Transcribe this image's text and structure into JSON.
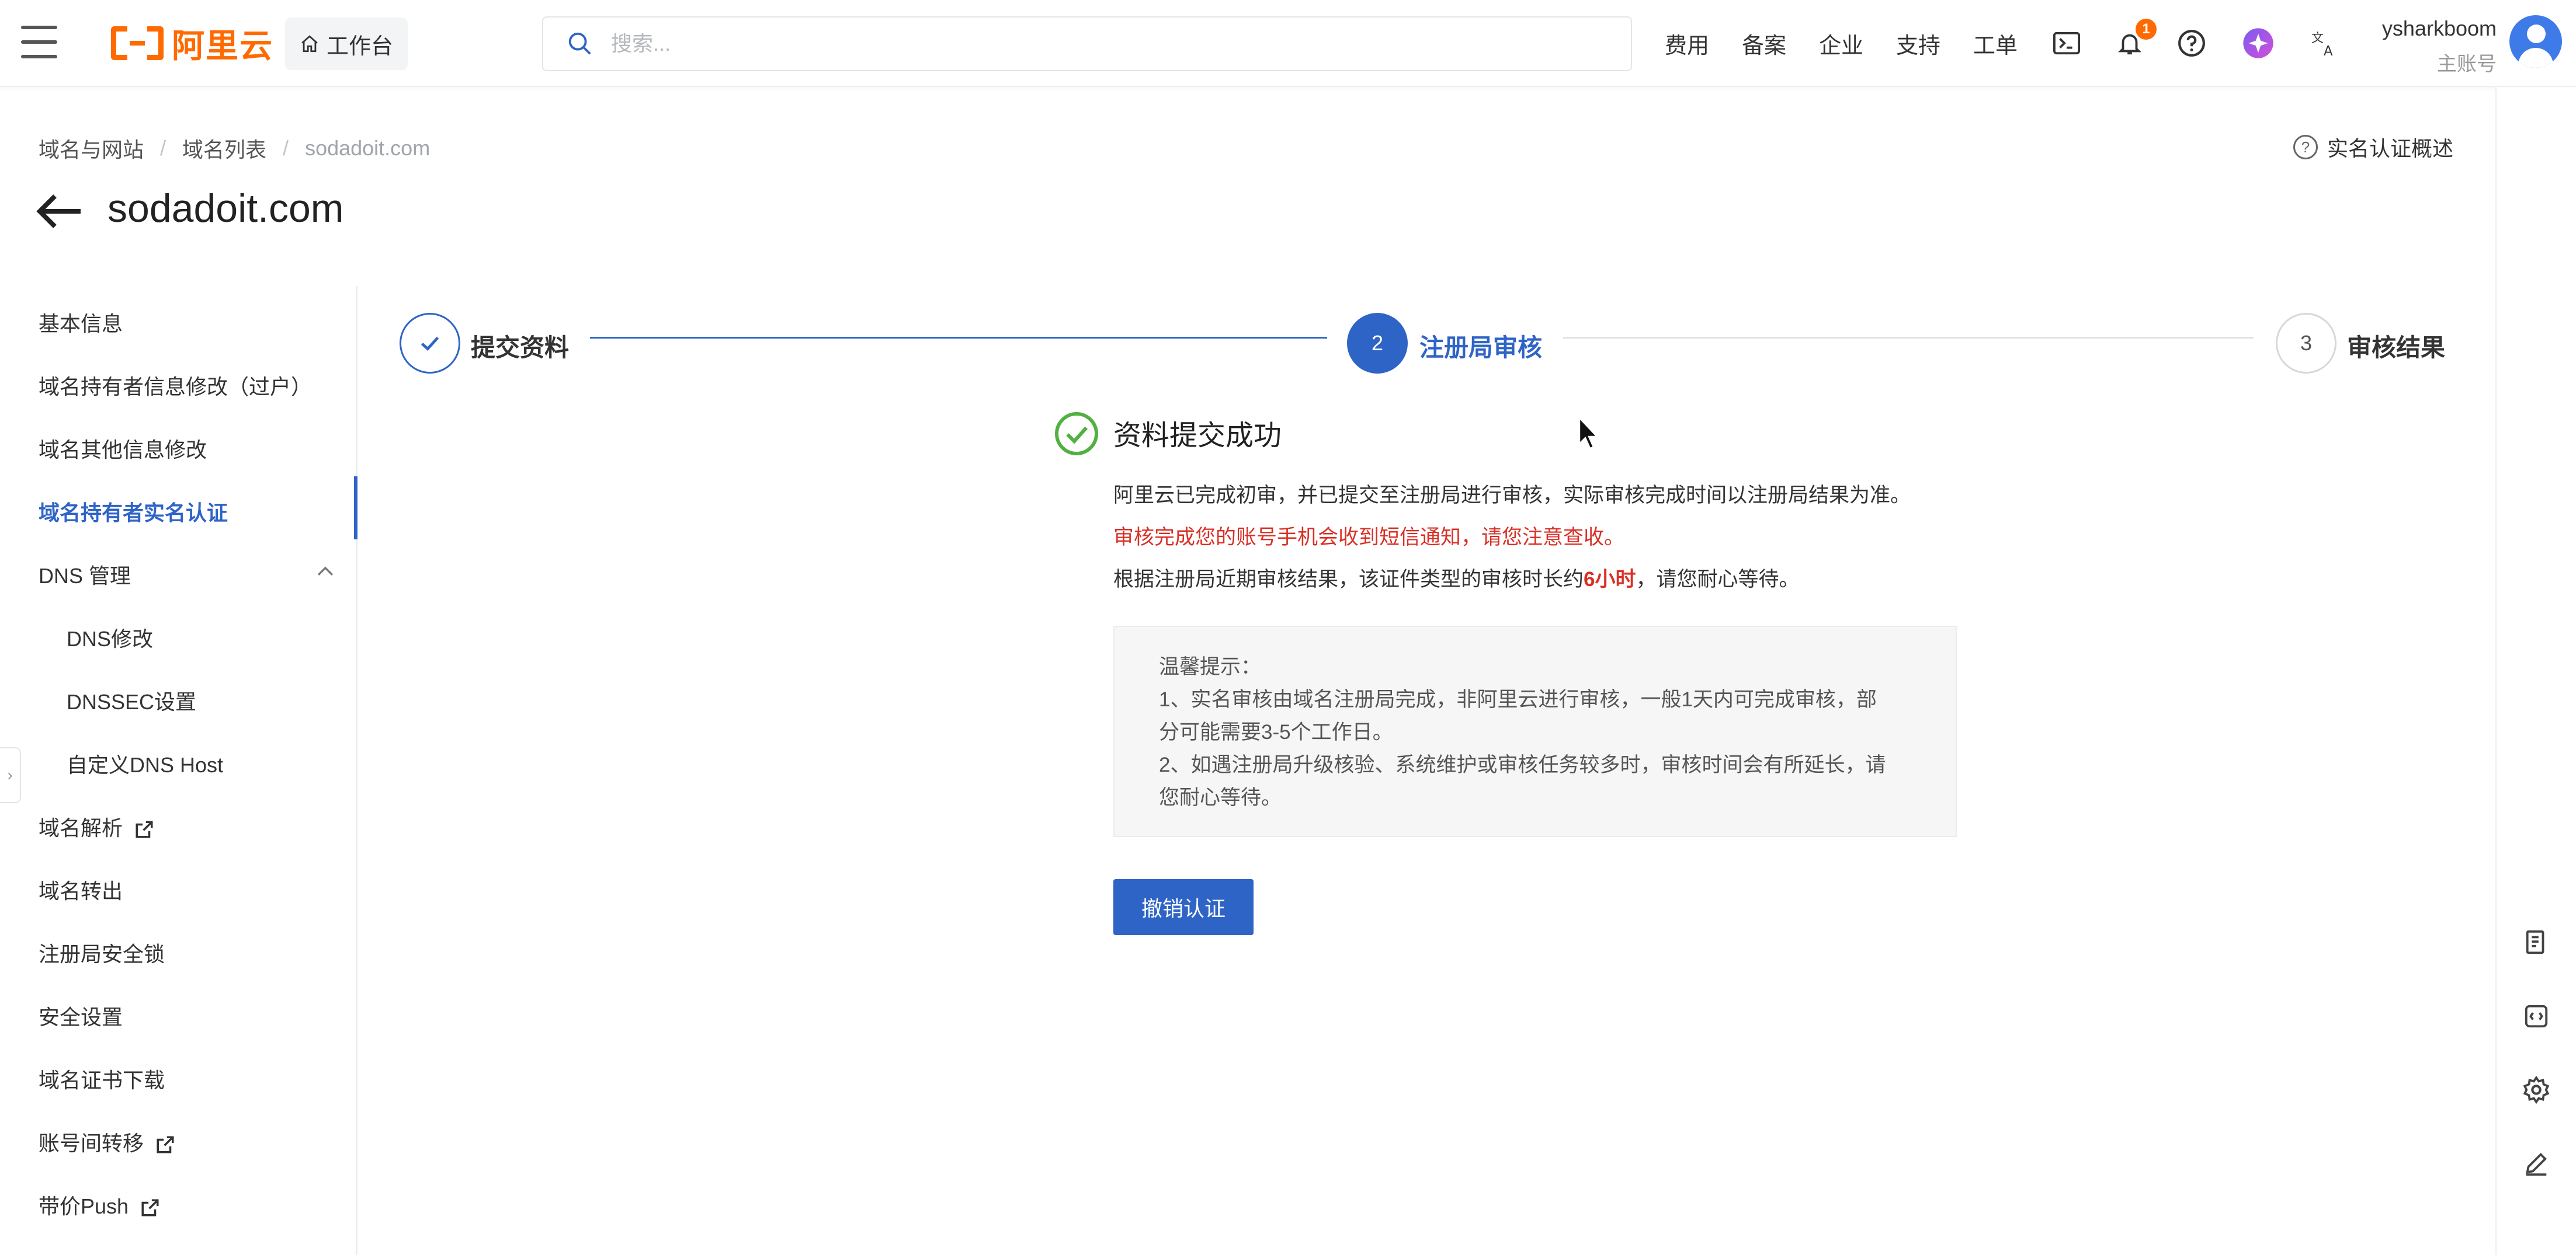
{
  "header": {
    "logo_text": "阿里云",
    "workbench_label": "工作台",
    "search_placeholder": "搜索...",
    "nav": [
      "费用",
      "备案",
      "企业",
      "支持",
      "工单"
    ],
    "notification_count": "1",
    "user_name": "ysharkboom",
    "user_role": "主账号",
    "icons": [
      "terminal-icon",
      "bell-icon",
      "help-icon",
      "ai-assistant-icon",
      "translate-icon"
    ]
  },
  "breadcrumb": {
    "items": [
      "域名与网站",
      "域名列表",
      "sodadoit.com"
    ],
    "help_link": "实名认证概述"
  },
  "page_title": "sodadoit.com",
  "sidebar": {
    "items": [
      {
        "label": "基本信息"
      },
      {
        "label": "域名持有者信息修改（过户）"
      },
      {
        "label": "域名其他信息修改"
      },
      {
        "label": "域名持有者实名认证",
        "active": true
      },
      {
        "label": "DNS 管理",
        "expanded": true
      },
      {
        "label": "DNS修改",
        "sub": true
      },
      {
        "label": "DNSSEC设置",
        "sub": true
      },
      {
        "label": "自定义DNS Host",
        "sub": true
      },
      {
        "label": "域名解析",
        "external": true
      },
      {
        "label": "域名转出"
      },
      {
        "label": "注册局安全锁"
      },
      {
        "label": "安全设置"
      },
      {
        "label": "域名证书下载"
      },
      {
        "label": "账号间转移",
        "external": true
      },
      {
        "label": "带价Push",
        "external": true
      }
    ]
  },
  "steps": [
    {
      "label": "提交资料",
      "status": "done"
    },
    {
      "label": "注册局审核",
      "status": "current",
      "number": "2"
    },
    {
      "label": "审核结果",
      "status": "pending",
      "number": "3"
    }
  ],
  "result": {
    "title": "资料提交成功",
    "line1": "阿里云已完成初审，并已提交至注册局进行审核，实际审核完成时间以注册局结果为准。",
    "line2": "审核完成您的账号手机会收到短信通知，请您注意查收。",
    "line3_prefix": "根据注册局近期审核结果，该证件类型的审核时长约",
    "line3_highlight": "6小时",
    "line3_suffix": "，请您耐心等待。"
  },
  "tips": {
    "title": "温馨提示：",
    "lines": [
      "1、实名审核由域名注册局完成，非阿里云进行审核，一般1天内可完成审核，部",
      "分可能需要3-5个工作日。",
      "2、如遇注册局升级核验、系统维护或审核任务较多时，审核时间会有所延长，请",
      "您耐心等待。"
    ]
  },
  "revoke_button": "撤销认证",
  "right_rail_icons": [
    "document-icon",
    "code-icon",
    "settings-icon",
    "edit-icon"
  ],
  "colors": {
    "brand": "#ff6a00",
    "primary": "#2f64c7",
    "success": "#52b043",
    "danger": "#d93026"
  }
}
